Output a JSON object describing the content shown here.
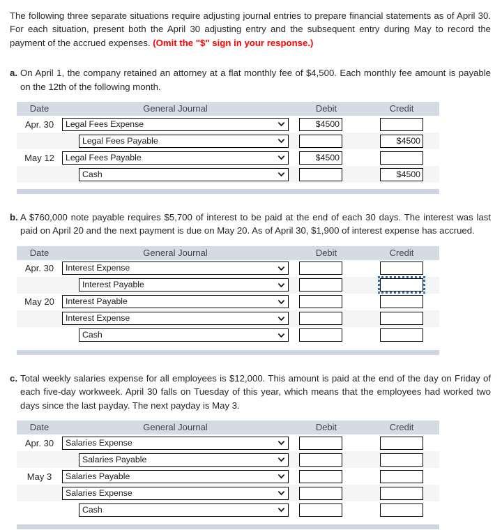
{
  "intro": {
    "text_before": "The following three separate situations require adjusting journal entries to prepare financial statements as of April 30. For each situation, present both the April 30 adjusting entry and the subsequent entry during May to record the payment of the accrued expenses. ",
    "omit_note": "(Omit the \"$\" sign in your response.)"
  },
  "colors": {
    "header_bar": "#d6dae4",
    "row_even": "#f5f5f6",
    "row_odd": "#ffffff",
    "footer_bar": "#ced4e0",
    "omit_red": "#fe0000",
    "focus_outline": "#2f6fb5"
  },
  "table_headers": {
    "date": "Date",
    "journal": "General Journal",
    "debit": "Debit",
    "credit": "Credit"
  },
  "icons": {
    "chevron": "chevron-down-icon"
  },
  "situations": [
    {
      "letter": "a.",
      "text": "On April 1, the company retained an attorney at a flat monthly fee of $4,500. Each monthly fee amount is payable on the 12th of the following month.",
      "rows": [
        {
          "date": "Apr. 30",
          "account": "Legal Fees Expense",
          "indent": 0,
          "debit": "$4500",
          "credit": ""
        },
        {
          "date": "",
          "account": "Legal Fees Payable",
          "indent": 1,
          "debit": "",
          "credit": "$4500"
        },
        {
          "date": "May 12",
          "account": "Legal Fees Payable",
          "indent": 0,
          "debit": "$4500",
          "credit": ""
        },
        {
          "date": "",
          "account": "Cash",
          "indent": 1,
          "debit": "",
          "credit": "$4500"
        }
      ]
    },
    {
      "letter": "b.",
      "text": "A $760,000 note payable requires $5,700 of interest to be paid at the end of each 30 days. The interest was last paid on April 20 and the next payment is due on May 20. As of April 30, $1,900 of interest expense has accrued.",
      "rows": [
        {
          "date": "Apr. 30",
          "account": "Interest Expense",
          "indent": 0,
          "debit": "",
          "credit": ""
        },
        {
          "date": "",
          "account": "Interest Payable",
          "indent": 1,
          "debit": "",
          "credit": "",
          "credit_focused": true
        },
        {
          "date": "May 20",
          "account": "Interest Payable",
          "indent": 0,
          "debit": "",
          "credit": ""
        },
        {
          "date": "",
          "account": "Interest Expense",
          "indent": 0,
          "debit": "",
          "credit": ""
        },
        {
          "date": "",
          "account": "Cash",
          "indent": 1,
          "debit": "",
          "credit": ""
        }
      ]
    },
    {
      "letter": "c.",
      "text": "Total weekly salaries expense for all employees is $12,000. This amount is paid at the end of the day on Friday of each five-day workweek. April 30 falls on Tuesday of this year, which means that the employees had worked two days since the last payday. The next payday is May 3.",
      "rows": [
        {
          "date": "Apr. 30",
          "account": "Salaries Expense",
          "indent": 0,
          "debit": "",
          "credit": ""
        },
        {
          "date": "",
          "account": "Salaries Payable",
          "indent": 1,
          "debit": "",
          "credit": ""
        },
        {
          "date": "May 3",
          "account": "Salaries Payable",
          "indent": 0,
          "debit": "",
          "credit": ""
        },
        {
          "date": "",
          "account": "Salaries Expense",
          "indent": 0,
          "debit": "",
          "credit": ""
        },
        {
          "date": "",
          "account": "Cash",
          "indent": 1,
          "debit": "",
          "credit": ""
        }
      ]
    }
  ]
}
